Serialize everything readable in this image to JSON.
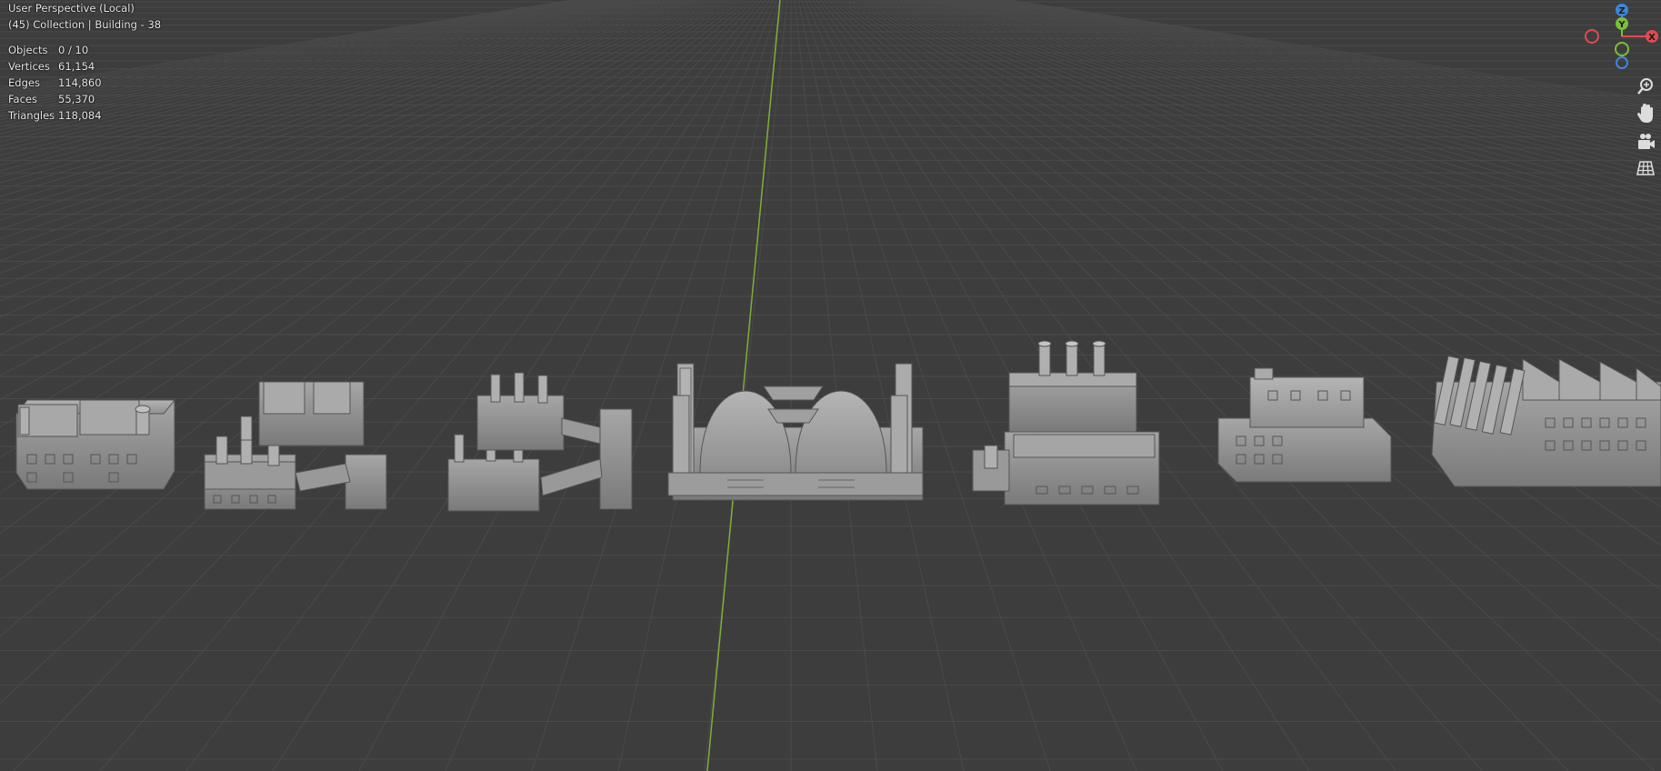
{
  "viewport": {
    "view_name": "User Perspective (Local)",
    "collection_line": "(45) Collection | Building - 38"
  },
  "stats": [
    {
      "label": "Objects",
      "value": "0 / 10"
    },
    {
      "label": "Vertices",
      "value": "61,154"
    },
    {
      "label": "Edges",
      "value": "114,860"
    },
    {
      "label": "Faces",
      "value": "55,370"
    },
    {
      "label": "Triangles",
      "value": "118,084"
    }
  ],
  "gizmo": {
    "z_label": "Z",
    "y_label": "Y",
    "x_label": "X",
    "colors": {
      "x": "#e04a55",
      "y": "#7bbf3a",
      "z": "#3f86d8"
    }
  },
  "nav_tools": [
    {
      "name": "zoom",
      "icon": "zoom-icon"
    },
    {
      "name": "pan",
      "icon": "hand-icon"
    },
    {
      "name": "camera",
      "icon": "camera-icon"
    },
    {
      "name": "ortho",
      "icon": "grid-icon"
    }
  ],
  "colors": {
    "background": "#3d3d3d",
    "grid": "#4a4a4a",
    "y_axis": "#7fae3a",
    "model": "#8a8a8a"
  }
}
